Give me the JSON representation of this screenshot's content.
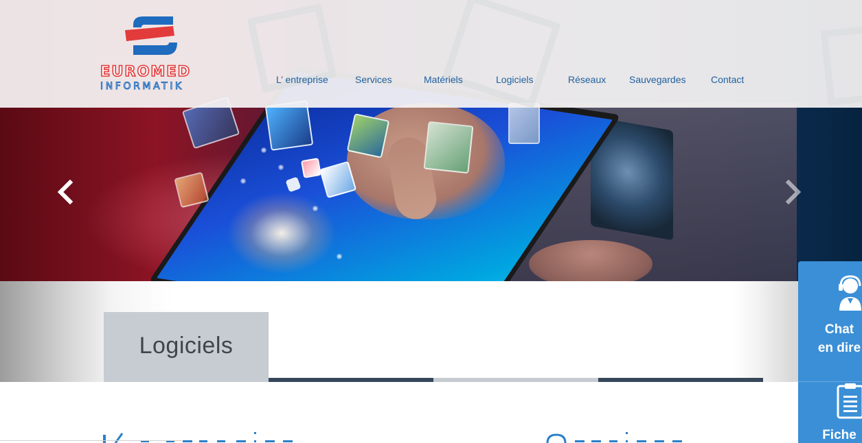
{
  "brand": {
    "name_line1": "EUROMED",
    "name_line2": "INFORMATIK",
    "colors": {
      "red": "#e23b3b",
      "blue": "#1f6bbd"
    }
  },
  "nav": {
    "items": [
      {
        "label": "L’ entreprise"
      },
      {
        "label": "Services"
      },
      {
        "label": "Matériels"
      },
      {
        "label": "Logiciels"
      },
      {
        "label": "Réseaux"
      },
      {
        "label": "Sauvegardes"
      },
      {
        "label": "Contact"
      }
    ],
    "color": "#1f5f9e"
  },
  "slider": {
    "prev_icon": "chevron-left-icon",
    "next_icon": "chevron-right-icon"
  },
  "section": {
    "tab_title": "Logiciels",
    "tab_color": "#c6ccd1",
    "bar_color": "#37475a"
  },
  "side_widget": {
    "chat_label_line1": "Chat",
    "chat_label_line2": "en dire",
    "fiche_label": "Fiche",
    "color": "#3b8fd6"
  }
}
